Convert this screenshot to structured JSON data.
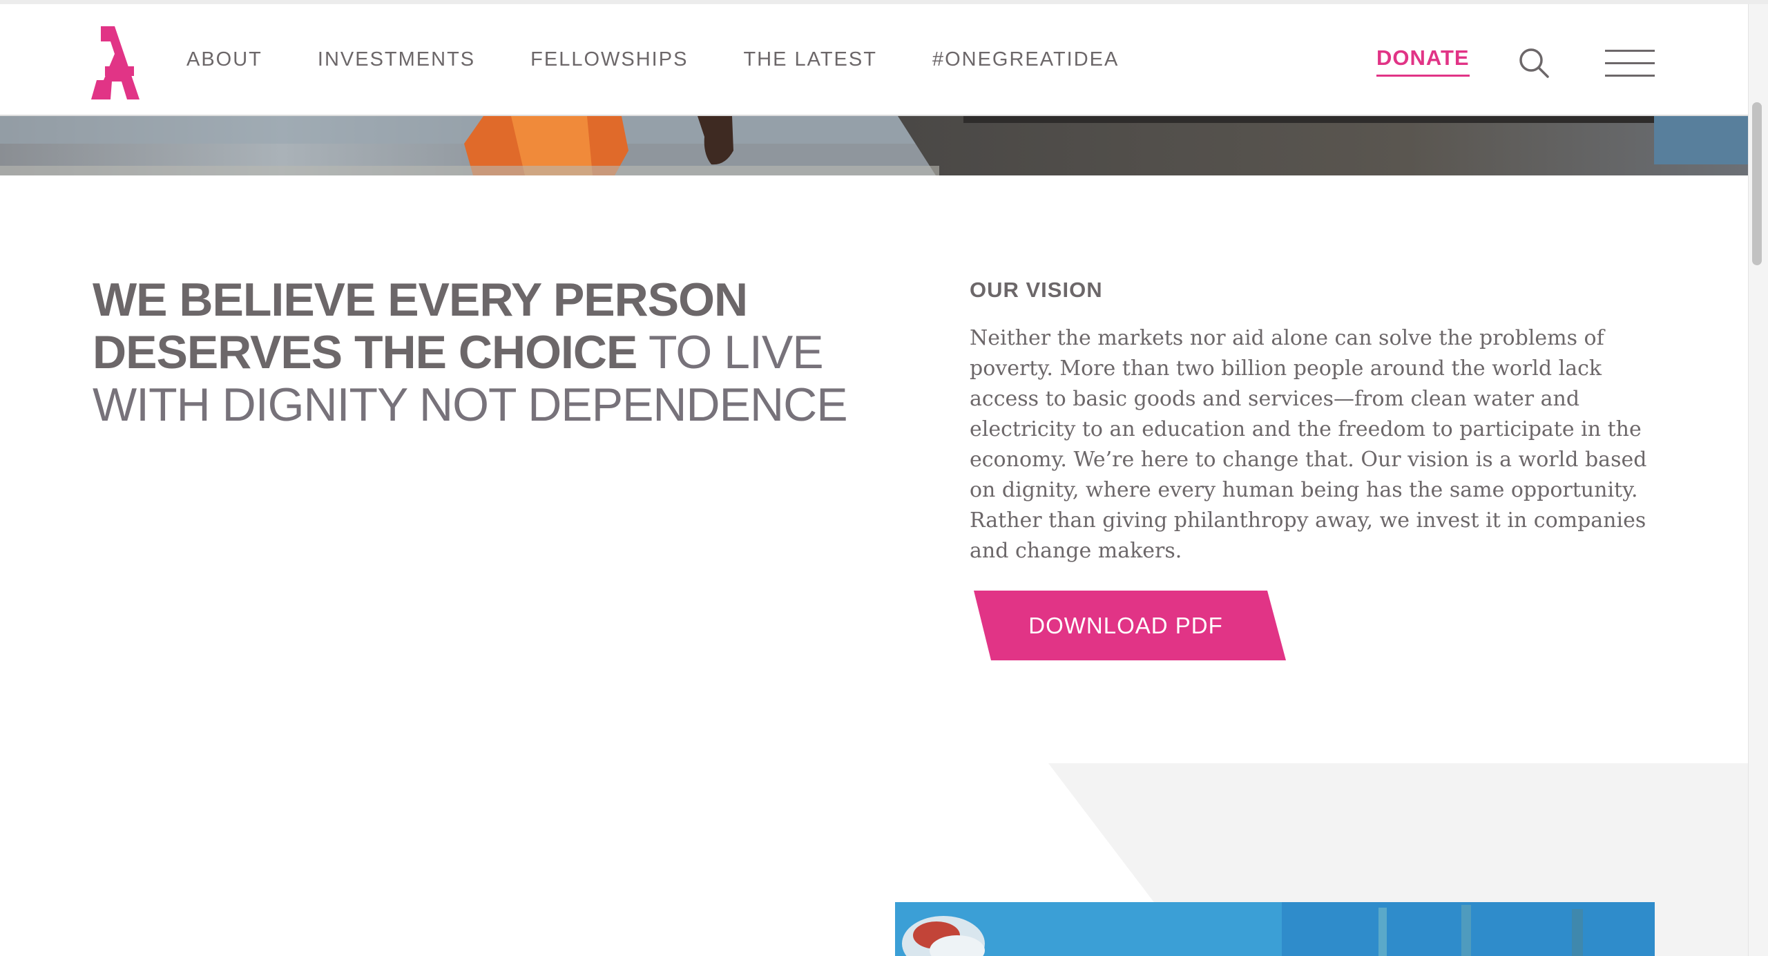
{
  "header": {
    "nav": [
      "ABOUT",
      "INVESTMENTS",
      "FELLOWSHIPS",
      "THE LATEST",
      "#ONEGREATIDEA"
    ],
    "donate_label": "DONATE"
  },
  "icons": {
    "logo": "acumen-a-logo-icon",
    "search": "search-icon",
    "menu": "hamburger-menu-icon"
  },
  "headline": {
    "bold_line1": "WE BELIEVE EVERY PERSON",
    "bold_line2": "DESERVES THE CHOICE",
    "light_tail": " TO LIVE",
    "light_line3": "WITH DIGNITY NOT DEPENDENCE"
  },
  "vision": {
    "title": "OUR VISION",
    "body": "Neither the markets nor aid alone can solve the problems of poverty. More than two billion people around the world lack access to basic goods and services—from clean water and electricity to an education and the freedom to participate in the economy. We’re here to change that. Our vision is a world based on dignity, where every human being has the same opportunity. Rather than giving philanthropy away, we invest it in companies and change makers.",
    "button_label": "DOWNLOAD PDF"
  },
  "colors": {
    "brand_pink": "#e13486",
    "text_gray": "#6c6769",
    "light_gray_panel": "#f3f3f3"
  }
}
